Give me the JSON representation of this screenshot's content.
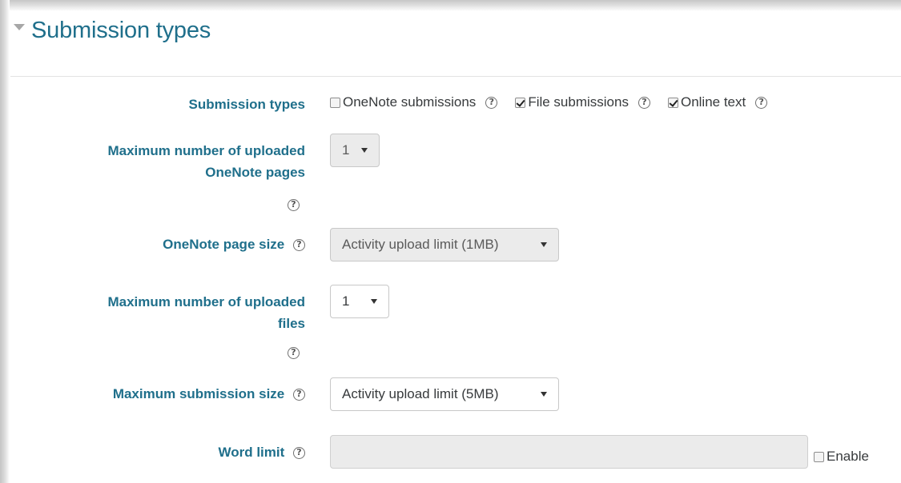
{
  "section": {
    "title": "Submission types"
  },
  "fields": {
    "submission_types": {
      "label": "Submission types",
      "options": [
        {
          "label": "OneNote submissions",
          "checked": false
        },
        {
          "label": "File submissions",
          "checked": true
        },
        {
          "label": "Online text",
          "checked": true
        }
      ]
    },
    "max_onenote_pages": {
      "label_line1": "Maximum number of uploaded",
      "label_line2": "OneNote pages",
      "value": "1",
      "disabled": true
    },
    "onenote_page_size": {
      "label": "OneNote page size",
      "value": "Activity upload limit (1MB)",
      "disabled": true
    },
    "max_uploaded_files": {
      "label_line1": "Maximum number of uploaded",
      "label_line2": "files",
      "value": "1",
      "disabled": false
    },
    "max_submission_size": {
      "label": "Maximum submission size",
      "value": "Activity upload limit (5MB)",
      "disabled": false
    },
    "word_limit": {
      "label": "Word limit",
      "value": "",
      "enable_label": "Enable",
      "enabled": false
    }
  },
  "help_glyph": "?",
  "colors": {
    "label": "#1f6f8b",
    "disabled_bg": "#ebebeb"
  }
}
